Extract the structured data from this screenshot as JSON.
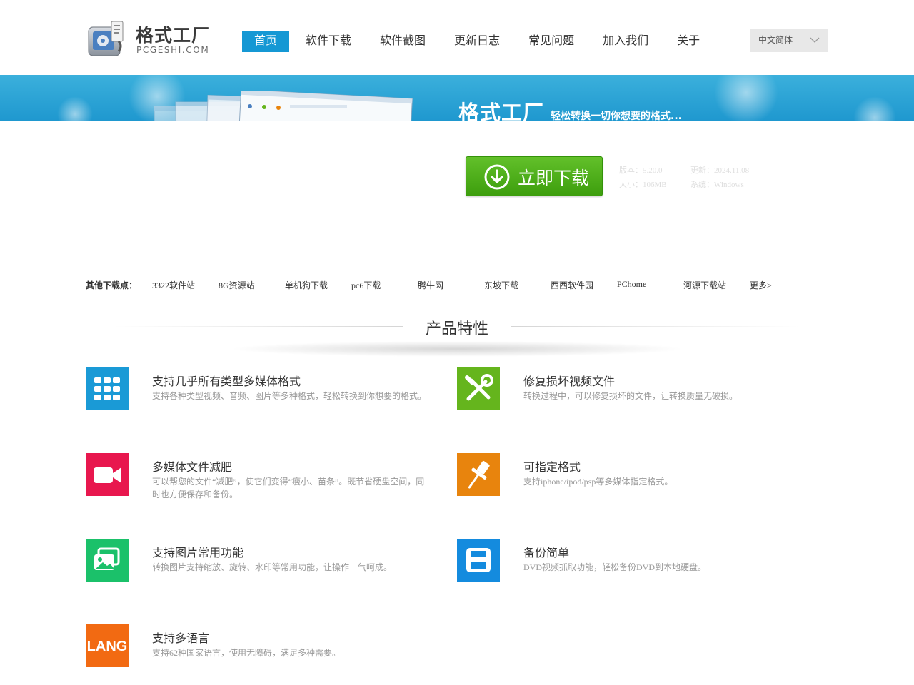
{
  "logo": {
    "title": "格式工厂",
    "subtitle": "PCGESHI.COM"
  },
  "nav": {
    "items": [
      {
        "label": "首页"
      },
      {
        "label": "软件下载"
      },
      {
        "label": "软件截图"
      },
      {
        "label": "更新日志"
      },
      {
        "label": "常见问题"
      },
      {
        "label": "加入我们"
      },
      {
        "label": "关于"
      }
    ],
    "active_index": 0
  },
  "language": {
    "selected": "中文简体"
  },
  "banner": {
    "title": "格式工厂",
    "slogan": "轻松转换一切你想要的格式..."
  },
  "download": {
    "button_label": "立即下载",
    "version": "版本：5.20.0",
    "updated": "更新：2024.11.08",
    "size": "大小：106MB",
    "system": "系统：Windows"
  },
  "other_downloads": {
    "label": "其他下载点：",
    "links": [
      "3322软件站",
      "8G资源站",
      "单机狗下载",
      "pc6下载",
      "腾牛网",
      "东坡下载",
      "西西软件园",
      "PChome",
      "河源下载站",
      "更多>"
    ]
  },
  "features": {
    "section_title": "产品特性",
    "items": [
      {
        "icon": "grid-apps-icon",
        "color": "#1a9ad6",
        "title": "支持几乎所有类型多媒体格式",
        "desc": "支持各种类型视频、音频、图片等多种格式，轻松转换到你想要的格式。"
      },
      {
        "icon": "repair-tools-icon",
        "color": "#65b51d",
        "title": "修复损坏视频文件",
        "desc": "转换过程中，可以修复损坏的文件，让转换质量无破损。"
      },
      {
        "icon": "video-camera-icon",
        "color": "#e8174e",
        "title": "多媒体文件减肥",
        "desc": "可以帮您的文件“减肥”，使它们变得“瘦小、苗条”。既节省硬盘空间，同时也方便保存和备份。"
      },
      {
        "icon": "pushpin-icon",
        "color": "#e8840d",
        "title": "可指定格式",
        "desc": "支持iphone/ipod/psp等多媒体指定格式。"
      },
      {
        "icon": "photo-gallery-icon",
        "color": "#1bc16a",
        "title": "支持图片常用功能",
        "desc": "转换图片支持缩放、旋转、水印等常用功能，让操作一气呵成。"
      },
      {
        "icon": "save-disk-icon",
        "color": "#148bde",
        "title": "备份简单",
        "desc": "DVD视频抓取功能，轻松备份DVD到本地硬盘。"
      },
      {
        "icon": "lang-text-icon",
        "color": "#f26a12",
        "title": "支持多语言",
        "desc": "支持62种国家语言，使用无障碍，满足多种需要。"
      }
    ]
  },
  "icon_text": {
    "lang": "LANG"
  }
}
